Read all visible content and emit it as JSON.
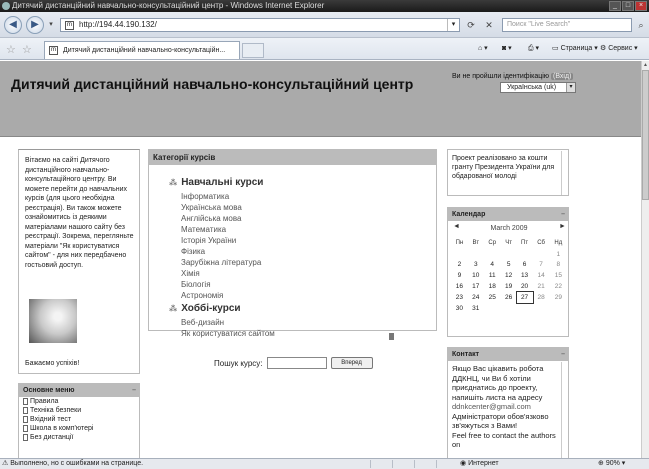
{
  "window": {
    "title": "Дитячий дистанційний навчально-консультаційний центр - Windows Internet Explorer"
  },
  "browser": {
    "address": "http://194.44.190.132/",
    "search_placeholder": "Поиск \"Live Search\"",
    "tab_title": "Дитячий дистанційний навчально-консультаційн...",
    "page_menu": "Страница",
    "tools_menu": "Сервис"
  },
  "site": {
    "title": "Дитячий дистанційний навчально-консультаційний центр",
    "login_info": "Ви не пройшли ідентифікацію",
    "login_link": "(Вхід)",
    "language": "Українська (uk)"
  },
  "left_panel": {
    "welcome": "Вітаємо на сайті Дитячого дистанційного навчально-консультаційного центру. Ви можете перейти до навчальних курсів (для цього необхідна реєстрація). Ви також можете ознайомитись із деякими матеріалами нашого сайту без реєстрації. Зокрема, перегляньте матеріали \"Як користуватися сайтом\" - для них передбачено гостьовий доступ.",
    "wish": "Бажаємо успіхів!"
  },
  "main_menu": {
    "title": "Основне меню",
    "items": [
      "Правила",
      "Техніка безпеки",
      "Вхідний тест",
      "Школа в комп'ютері",
      "Без дистанції"
    ]
  },
  "categories": {
    "title": "Категорії курсів",
    "group1": "Навчальні курси",
    "group1_items": [
      "Інформатика",
      "Українська мова",
      "Англійська мова",
      "Математика",
      "Історія України",
      "Фізика",
      "Зарубіжна література",
      "Хімія",
      "Біологія",
      "Астрономія"
    ],
    "group2": "Хоббі-курси",
    "group2_items": [
      "Веб-дизайн",
      "Як користуватися сайтом"
    ]
  },
  "course_search": {
    "label": "Пошук курсу:",
    "button": "Вперед"
  },
  "project_box": {
    "text": "Проект реалізовано за кошти гранту Президента України для обдарованої молоді"
  },
  "calendar": {
    "title": "Календар",
    "month": "March 2009",
    "days": [
      "Пн",
      "Вт",
      "Ср",
      "Чт",
      "Пт",
      "Сб",
      "Нд"
    ],
    "weeks": [
      [
        "",
        "",
        "",
        "",
        "",
        "",
        "1"
      ],
      [
        "2",
        "3",
        "4",
        "5",
        "6",
        "7",
        "8"
      ],
      [
        "9",
        "10",
        "11",
        "12",
        "13",
        "14",
        "15"
      ],
      [
        "16",
        "17",
        "18",
        "19",
        "20",
        "21",
        "22"
      ],
      [
        "23",
        "24",
        "25",
        "26",
        "27",
        "28",
        "29"
      ],
      [
        "30",
        "31",
        "",
        "",
        "",
        "",
        ""
      ]
    ],
    "today": "27"
  },
  "contact": {
    "title": "Контакт",
    "text": "Якщо Вас цікавить робота ДДКНЦ, чи Ви б хотіли приєднатись до проекту, напишіть листа на адресу",
    "email": "ddnkcenter@gmail.com",
    "text2": "Адміністратори обов'язково зв'яжуться з Вами!",
    "text3": "Feel free to contact the authors on"
  },
  "status": {
    "message": "Выполнено, но с ошибками на странице.",
    "zone": "Интернет",
    "zoom": "90%"
  }
}
